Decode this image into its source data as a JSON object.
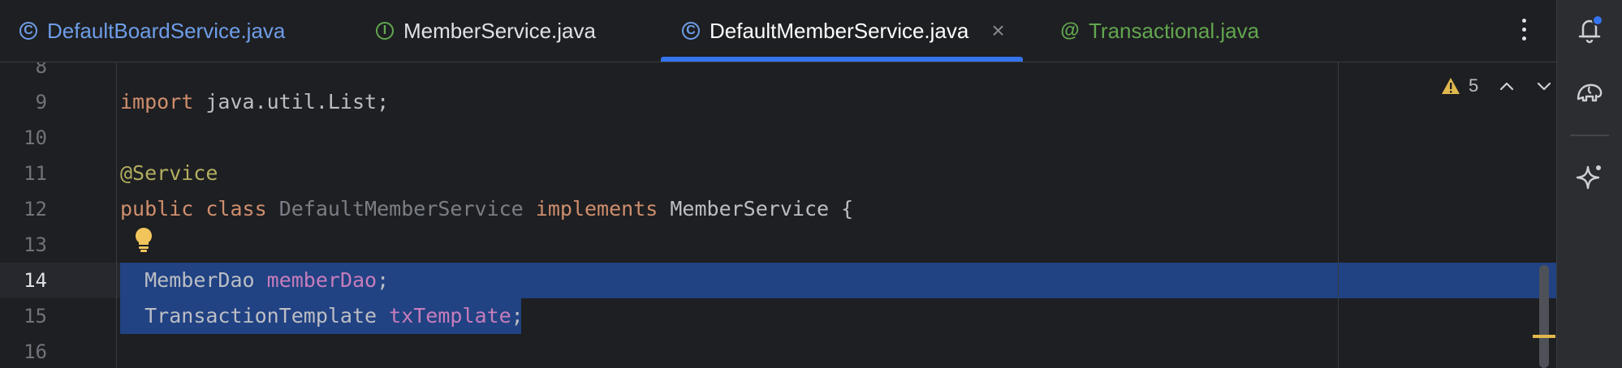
{
  "tabs": [
    {
      "label": "DefaultBoardService.java",
      "icon": "class-icon",
      "color": "#6e9de8"
    },
    {
      "label": "MemberService.java",
      "icon": "interface-icon",
      "color": "#dfe1e5"
    },
    {
      "label": "DefaultMemberService.java",
      "icon": "class-icon",
      "color": "#ffffff",
      "active": true
    },
    {
      "label": "Transactional.java",
      "icon": "annotation-icon",
      "color": "#62a64f"
    }
  ],
  "tab_icon_letters": {
    "class": "C",
    "interface": "I",
    "annotation": "@"
  },
  "tab_close": "×",
  "editor": {
    "line_numbers": [
      "8",
      "9",
      "10",
      "11",
      "12",
      "13",
      "14",
      "15",
      "16"
    ],
    "current_line": "14",
    "lines": {
      "l9": {
        "kw": "import",
        "rest": " java.util.List;"
      },
      "l11": {
        "ann": "@Service"
      },
      "l12": {
        "kw1": "public",
        "kw2": "class",
        "cls": "DefaultMemberService",
        "kw3": "implements",
        "iface": "MemberService",
        "brace": " {"
      },
      "l14": {
        "type": "MemberDao",
        "field": "memberDao",
        "semi": ";"
      },
      "l15": {
        "type": "TransactionTemplate",
        "field": "txTemplate",
        "semi": ";"
      }
    },
    "warnings_count": "5"
  },
  "colors": {
    "background": "#1e1f22",
    "selection": "#214283",
    "tab_underline": "#3574f0",
    "keyword": "#cf8e6d",
    "annotation": "#b3ae60",
    "field": "#c77dbb",
    "warning": "#e0b84c"
  }
}
